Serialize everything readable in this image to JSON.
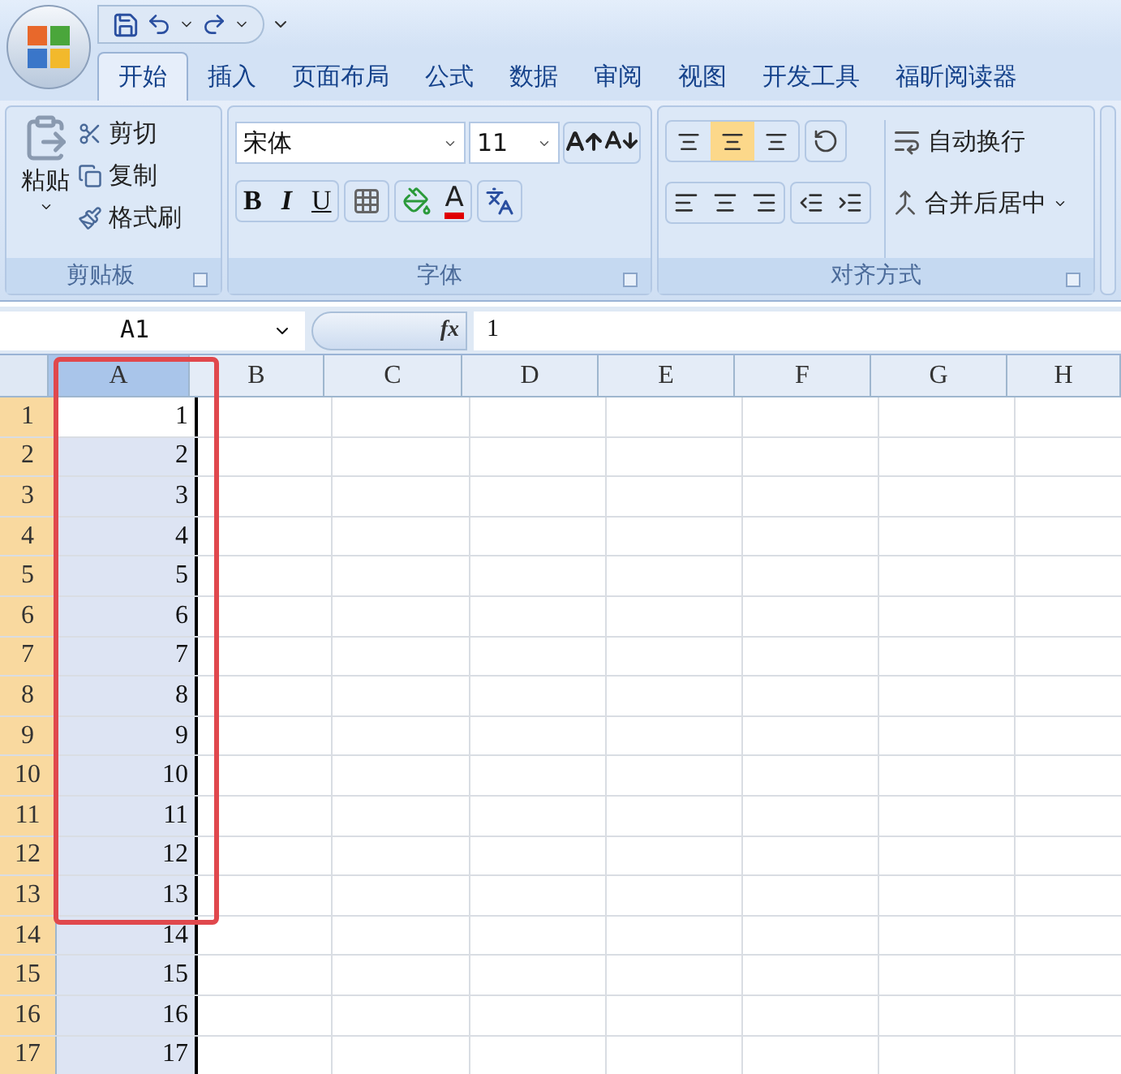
{
  "tabs": [
    {
      "label": "开始",
      "selected": true
    },
    {
      "label": "插入",
      "selected": false
    },
    {
      "label": "页面布局",
      "selected": false
    },
    {
      "label": "公式",
      "selected": false
    },
    {
      "label": "数据",
      "selected": false
    },
    {
      "label": "审阅",
      "selected": false
    },
    {
      "label": "视图",
      "selected": false
    },
    {
      "label": "开发工具",
      "selected": false
    },
    {
      "label": "福昕阅读器",
      "selected": false
    }
  ],
  "clipboard": {
    "paste": "粘贴",
    "items": [
      "剪切",
      "复制",
      "格式刷"
    ],
    "title": "剪贴板"
  },
  "font": {
    "name": "宋体",
    "size": "11",
    "bold": "B",
    "italic": "I",
    "underline": "U",
    "color_letter": "A",
    "title": "字体"
  },
  "alignment": {
    "vertical": [
      {
        "selected": false
      },
      {
        "selected": true
      },
      {
        "selected": false
      }
    ],
    "wrap": "自动换行",
    "merge": "合并后居中",
    "title": "对齐方式"
  },
  "formula_bar": {
    "name_box": "A1",
    "fx": "fx",
    "value": "1"
  },
  "columns": [
    {
      "label": "A",
      "selected": true
    },
    {
      "label": "B",
      "selected": false
    },
    {
      "label": "C",
      "selected": false
    },
    {
      "label": "D",
      "selected": false
    },
    {
      "label": "E",
      "selected": false
    },
    {
      "label": "F",
      "selected": false
    },
    {
      "label": "G",
      "selected": false
    },
    {
      "label": "H",
      "selected": false
    }
  ],
  "rows": [
    {
      "label": "1",
      "value": "1",
      "outlined": true
    },
    {
      "label": "2",
      "value": "2",
      "outlined": true
    },
    {
      "label": "3",
      "value": "3",
      "outlined": true
    },
    {
      "label": "4",
      "value": "4",
      "outlined": true
    },
    {
      "label": "5",
      "value": "5",
      "outlined": true
    },
    {
      "label": "6",
      "value": "6",
      "outlined": true
    },
    {
      "label": "7",
      "value": "7",
      "outlined": true
    },
    {
      "label": "8",
      "value": "8",
      "outlined": true
    },
    {
      "label": "9",
      "value": "9",
      "outlined": true
    },
    {
      "label": "10",
      "value": "10",
      "outlined": true
    },
    {
      "label": "11",
      "value": "11",
      "outlined": true
    },
    {
      "label": "12",
      "value": "12",
      "outlined": true
    },
    {
      "label": "13",
      "value": "13",
      "outlined": true
    },
    {
      "label": "14",
      "value": "14",
      "outlined": false
    },
    {
      "label": "15",
      "value": "15",
      "outlined": false
    },
    {
      "label": "16",
      "value": "16",
      "outlined": false
    },
    {
      "label": "17",
      "value": "17",
      "outlined": false
    }
  ]
}
